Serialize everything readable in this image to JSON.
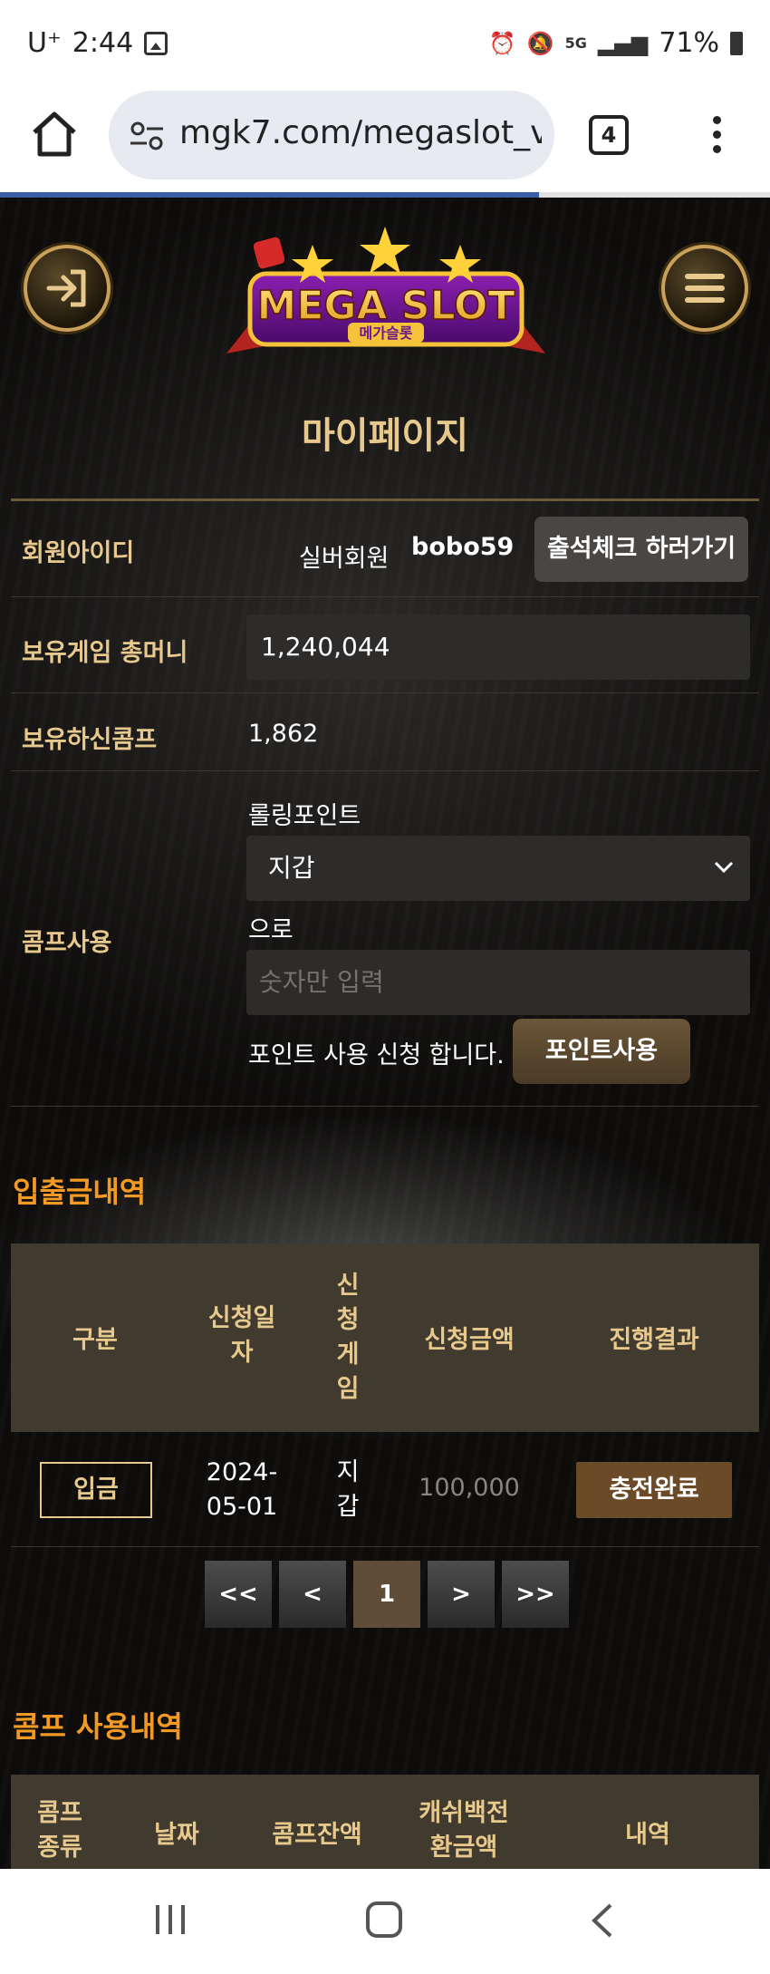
{
  "status_bar": {
    "carrier": "U⁺",
    "time": "2:44",
    "network": "5G",
    "battery": "71%"
  },
  "browser": {
    "url": "mgk7.com/megaslot_v",
    "tab_count": "4"
  },
  "logo": {
    "title": "MEGA SLOT",
    "subtitle": "메가슬롯"
  },
  "page": {
    "title": "마이페이지"
  },
  "profile": {
    "member_id_label": "회원아이디",
    "member_grade": "실버회원",
    "member_id": "bobo59",
    "attendance_button": "출석체크 하러가기",
    "money_label": "보유게임 총머니",
    "money_value": "1,240,044",
    "comp_label": "보유하신콤프",
    "comp_value": "1,862",
    "comp_use_label": "콤프사용",
    "rolling_point_label": "롤링포인트",
    "wallet_select": "지갑",
    "to_text": "으로",
    "amount_placeholder": "숫자만 입력",
    "apply_text": "포인트 사용 신청 합니다.",
    "point_use_button": "포인트사용"
  },
  "transactions": {
    "title": "입출금내역",
    "headers": [
      "구분",
      "신청일자",
      "신청게임",
      "신청금액",
      "진행결과"
    ],
    "rows": [
      {
        "type": "입금",
        "date": "2024-05-01",
        "game": "지갑",
        "amount": "100,000",
        "result": "충전완료"
      }
    ]
  },
  "pagination": {
    "first": "<<",
    "prev": "<",
    "current": "1",
    "next": ">",
    "last": ">>"
  },
  "comp_history": {
    "title": "콤프 사용내역",
    "headers": [
      "콤프종류",
      "날짜",
      "콤프잔액",
      "캐쉬백전환금액",
      "내역"
    ]
  },
  "colors": {
    "gold": "#e7c98e",
    "orange": "#f39a25",
    "table_header": "#413a2e"
  }
}
